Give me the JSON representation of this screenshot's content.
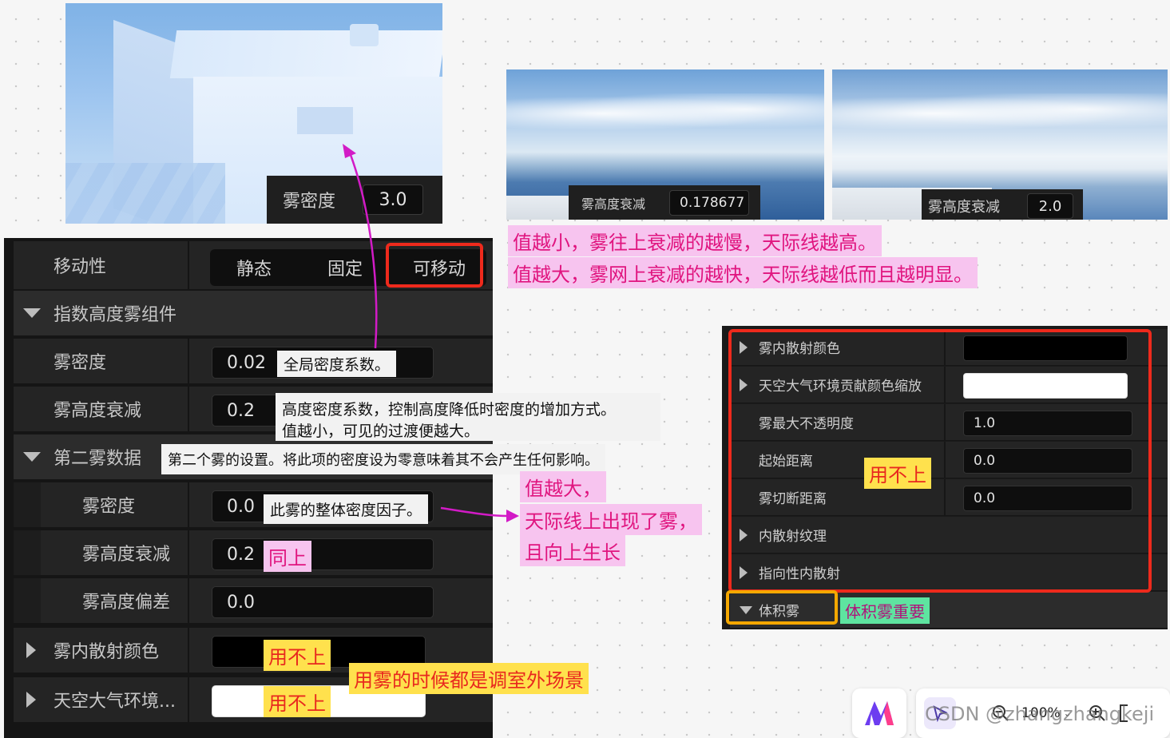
{
  "scene1": {
    "overlay_label": "雾密度",
    "overlay_value": "3.0"
  },
  "scene2": {
    "overlay_label": "雾高度衰减",
    "overlay_value": "0.178677"
  },
  "scene3": {
    "overlay_label": "雾高度衰减",
    "overlay_value": "2.0"
  },
  "note_height_falloff": {
    "line1": "值越小，雾往上衰减的越慢，天际线越高。",
    "line2": "值越大，雾网上衰减的越快，天际线越低而且越明显。"
  },
  "panel": {
    "mobility": {
      "label": "移动性",
      "options": [
        "静态",
        "固定",
        "可移动"
      ]
    },
    "component_header": "指数高度雾组件",
    "fog_density": {
      "label": "雾密度",
      "value": "0.02"
    },
    "fog_height_falloff": {
      "label": "雾高度衰减",
      "value": "0.2"
    },
    "second_fog": {
      "label": "第二雾数据"
    },
    "second_fog_density": {
      "label": "雾密度",
      "value": "0.0"
    },
    "second_fog_height_falloff": {
      "label": "雾高度衰减",
      "value": "0.2"
    },
    "second_fog_height_offset": {
      "label": "雾高度偏差",
      "value": "0.0"
    },
    "inscattering_color": {
      "label": "雾内散射颜色"
    },
    "sky_atmosphere": {
      "label": "天空大气环境..."
    }
  },
  "notes": {
    "global_density": "全局密度系数。",
    "height_density_1": "高度密度系数，控制高度降低时密度的增加方式。",
    "height_density_2": "值越小，可见的过渡便越大。",
    "second_fog": "第二个雾的设置。将此项的密度设为零意味着其不会产生任何影响。",
    "overall_density": "此雾的整体密度因子。",
    "same_as_above": "同上",
    "unused_1": "用不上",
    "unused_2": "用不上",
    "unused_3": "用不上",
    "outdoor": "用雾的时候都是调室外场景",
    "bigger_1": "值越大，",
    "bigger_2": "天际线上出现了雾，",
    "bigger_3": "且向上生长",
    "volumetric_important": "体积雾重要"
  },
  "rpanel": {
    "rows": [
      {
        "label": "雾内散射颜色",
        "value": ""
      },
      {
        "label": "天空大气环境贡献颜色缩放",
        "value": ""
      },
      {
        "label": "雾最大不透明度",
        "value": "1.0"
      },
      {
        "label": "起始距离",
        "value": "0.0"
      },
      {
        "label": "雾切断距离",
        "value": "0.0"
      },
      {
        "label": "内散射纹理",
        "value": ""
      },
      {
        "label": "指向性内散射",
        "value": ""
      },
      {
        "label": "体积雾",
        "value": ""
      }
    ]
  },
  "toolbar": {
    "zoom": "100%",
    "watermark": "CSDN @zhangzhangkeji"
  },
  "colors": {
    "accent_red": "#ee2a1c",
    "accent_orange": "#f5a800",
    "pink": "#e0157f",
    "magenta_arrow": "#d21bc6"
  }
}
